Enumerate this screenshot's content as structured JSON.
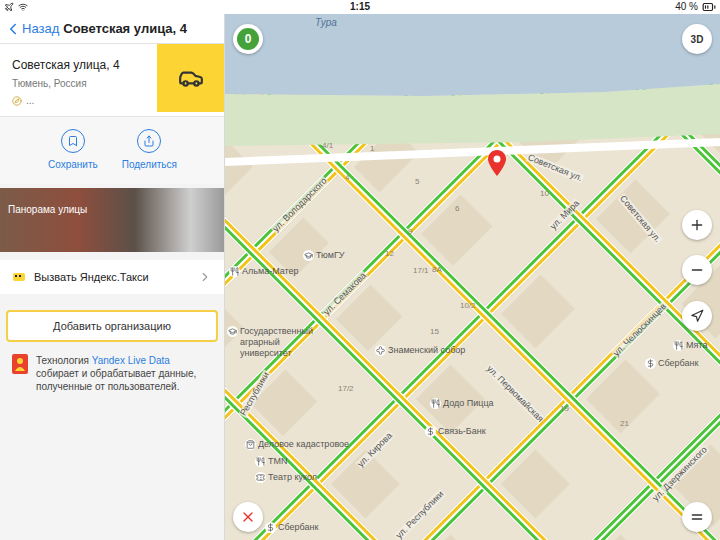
{
  "status_bar": {
    "time": "1:15",
    "battery": "40 %"
  },
  "header": {
    "back": "Назад",
    "title": "Советская улица, 4"
  },
  "place": {
    "name": "Советская улица, 4",
    "city": "Тюмень, Россия",
    "distance": "..."
  },
  "actions": [
    {
      "label": "Сохранить",
      "kind": "save"
    },
    {
      "label": "Поделиться",
      "kind": "share"
    }
  ],
  "panorama": {
    "label": "Панорама улицы"
  },
  "taxi": {
    "label": "Вызвать Яндекс.Такси"
  },
  "add_org": {
    "label": "Добавить организацию"
  },
  "live_data": {
    "prefix": "Технология",
    "brand": "Yandex Live Data",
    "rest": "собирает и обрабатывает данные, полученные от пользователей."
  },
  "map": {
    "traffic_score": "0",
    "view_3d": "3D",
    "river": "Тура",
    "roads": [
      {
        "directions": [
          {
            "color": "#4cc43a"
          },
          {
            "color": "#4cc43a"
          }
        ]
      },
      {
        "directions": [
          {
            "color": "#4cc43a"
          },
          {
            "color": "#f2c318"
          }
        ]
      },
      {
        "directions": [
          {
            "color": "#4cc43a"
          },
          {
            "color": "#f2c318"
          }
        ]
      },
      {
        "directions": [
          {
            "color": "#4cc43a"
          },
          {
            "color": "#f2c318"
          }
        ]
      },
      {
        "directions": [
          {
            "color": "#f2c318"
          },
          {
            "color": "#4cc43a"
          }
        ]
      },
      {
        "directions": [
          {
            "color": "#4cc43a"
          },
          {
            "color": "#4cc43a"
          }
        ]
      },
      {
        "directions": [
          {
            "color": "#4cc43a"
          },
          {
            "color": "#f2c318"
          }
        ]
      },
      {
        "directions": [
          {
            "color": "#4cc43a"
          },
          {
            "color": "#f2c318"
          }
        ]
      },
      {
        "directions": [
          {
            "color": "#f2c318"
          },
          {
            "color": "#4cc43a"
          }
        ]
      },
      {
        "directions": [
          {
            "color": "#4cc43a"
          },
          {
            "color": "#f2c318"
          }
        ]
      },
      {
        "directions": [
          {
            "color": "#4cc43a"
          },
          {
            "color": "#4cc43a"
          }
        ]
      }
    ],
    "streets": [
      {
        "text": "ул. Володарского"
      },
      {
        "text": "ул. Семакова"
      },
      {
        "text": "Советская ул."
      },
      {
        "text": "ул. Мира"
      },
      {
        "text": "Советская ул."
      },
      {
        "text": "ул. Челюскинцев"
      },
      {
        "text": "ул. Кирова"
      },
      {
        "text": "ул. Республики"
      },
      {
        "text": "ул. Дзержинского"
      },
      {
        "text": "Республики"
      },
      {
        "text": "ул. Первомайская"
      }
    ],
    "pois": [
      {
        "text": "Альма-Матер",
        "kind": "food"
      },
      {
        "text": "ТюмГУ",
        "kind": "school"
      },
      {
        "text": "Знаменский собор",
        "kind": "church"
      },
      {
        "text": "Государственный аграрный университет",
        "kind": "school"
      },
      {
        "text": "Додо Пицца",
        "kind": "food"
      },
      {
        "text": "Связь-Банк",
        "kind": "bank"
      },
      {
        "text": "Деловое кадастровое",
        "kind": "shop"
      },
      {
        "text": "TMN",
        "kind": "food"
      },
      {
        "text": "Театр кукол",
        "kind": "theatre"
      },
      {
        "text": "Сбербанк",
        "kind": "bank"
      },
      {
        "text": "Сбербанк",
        "kind": "bank"
      },
      {
        "text": "Мята",
        "kind": "food"
      }
    ],
    "numbers": [
      {
        "text": "4/1"
      },
      {
        "text": "4"
      },
      {
        "text": "5"
      },
      {
        "text": "1"
      },
      {
        "text": "6"
      },
      {
        "text": "9"
      },
      {
        "text": "12"
      },
      {
        "text": "17/1"
      },
      {
        "text": "8А"
      },
      {
        "text": "10/2"
      },
      {
        "text": "10"
      },
      {
        "text": "15"
      },
      {
        "text": "17/2"
      },
      {
        "text": "19"
      },
      {
        "text": "21"
      }
    ]
  }
}
